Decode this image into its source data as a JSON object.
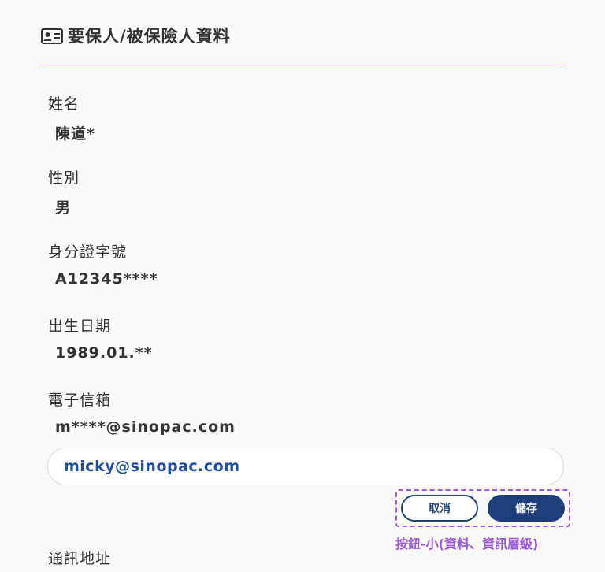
{
  "header": {
    "icon": "id-card-icon",
    "title": "要保人/被保險人資料"
  },
  "fields": {
    "name": {
      "label": "姓名",
      "value": "陳道*"
    },
    "gender": {
      "label": "性別",
      "value": "男"
    },
    "id_number": {
      "label": "身分證字號",
      "value": "A12345****"
    },
    "birthdate": {
      "label": "出生日期",
      "value": "1989.01.**"
    },
    "email": {
      "label": "電子信箱",
      "value": "m****@sinopac.com",
      "input_value": "micky@sinopac.com"
    },
    "address": {
      "label": "通訊地址"
    }
  },
  "actions": {
    "cancel_label": "取消",
    "save_label": "儲存",
    "annotation": "按鈕-小(資料、資訊層級)"
  },
  "colors": {
    "accent_gold": "#c9a441",
    "primary_navy": "#1f3f7a",
    "input_text_blue": "#1f4d99",
    "annotation_purple": "#9b59d6"
  }
}
